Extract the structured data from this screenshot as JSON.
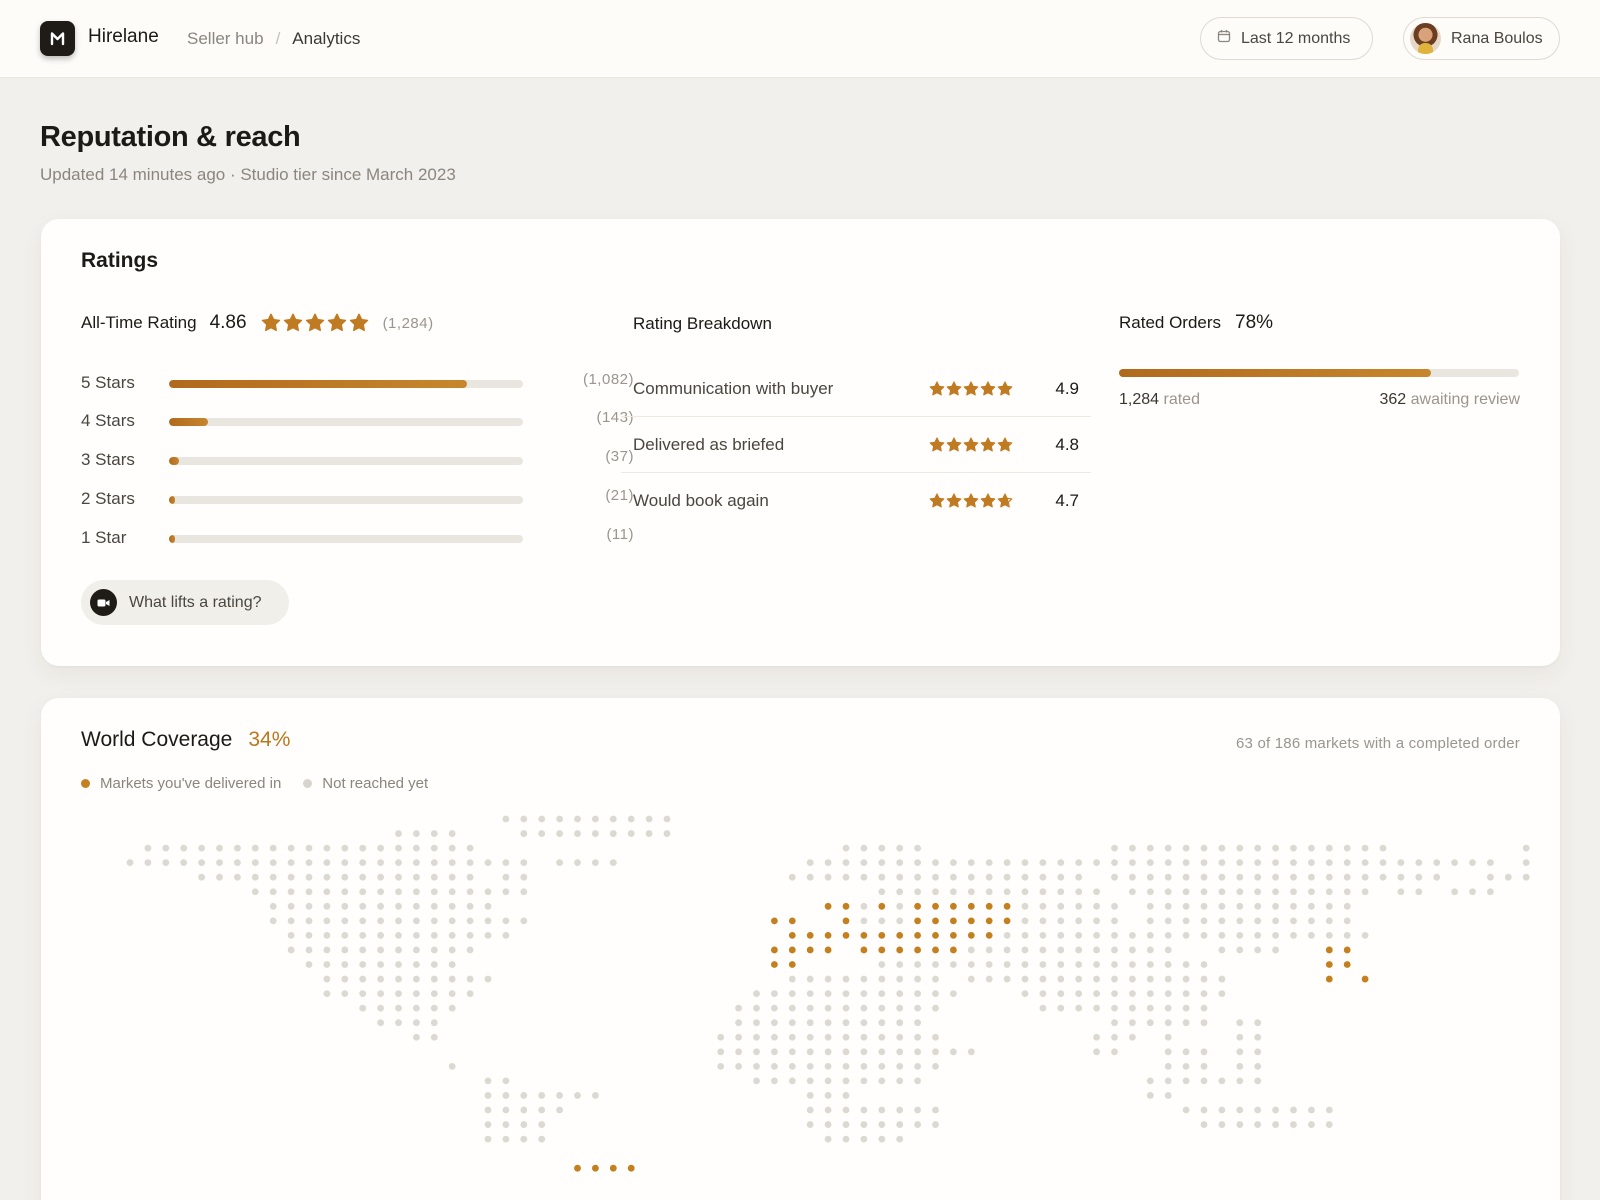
{
  "header": {
    "brand": "Hirelane",
    "breadcrumb": [
      "Seller hub",
      "Analytics"
    ],
    "date_range": "Last 12 months",
    "user_name": "Rana Boulos"
  },
  "page": {
    "title": "Reputation & reach",
    "subtitle": "Updated 14 minutes ago · Studio tier since March 2023"
  },
  "ratings": {
    "title": "Ratings",
    "all_time_label": "All-Time Rating",
    "all_time_score": "4.86",
    "all_time_stars": 4.86,
    "all_time_count": "(1,284)",
    "distribution": [
      {
        "label": "5 Stars",
        "count": "(1,082)",
        "fraction": 0.843
      },
      {
        "label": "4 Stars",
        "count": "(143)",
        "fraction": 0.111
      },
      {
        "label": "3 Stars",
        "count": "(37)",
        "fraction": 0.029
      },
      {
        "label": "2 Stars",
        "count": "(21)",
        "fraction": 0.016
      },
      {
        "label": "1 Star",
        "count": "(11)",
        "fraction": 0.009
      }
    ],
    "help_label": "What lifts a rating?",
    "breakdown_title": "Rating Breakdown",
    "breakdown": [
      {
        "label": "Communication with buyer",
        "value": "4.9",
        "stars": 4.9
      },
      {
        "label": "Delivered as briefed",
        "value": "4.8",
        "stars": 4.8
      },
      {
        "label": "Would book again",
        "value": "4.7",
        "stars": 4.7
      }
    ],
    "rated_orders_label": "Rated Orders",
    "rated_orders_pct": "78%",
    "rated_orders_fraction": 0.78,
    "rated_count": "1,284",
    "rated_suffix": "rated",
    "awaiting_count": "362",
    "awaiting_suffix": "awaiting review"
  },
  "coverage": {
    "title": "World Coverage",
    "pct": "34%",
    "note": "63 of 186 markets with a completed order",
    "legend_delivered": "Markets you've delivered in",
    "legend_not_reached": "Not reached yet"
  },
  "colors": {
    "accent": "#b8781f",
    "star": "#c07a22",
    "track": "#e9e6df",
    "dot_grey": "#dcd9d2",
    "dot_gold": "#c4801f",
    "background": "#f2f0ec",
    "card": "#fffefc"
  },
  "icons": {
    "logo": "hirelane-logo-icon",
    "date": "calendar-icon",
    "help": "video-camera-icon",
    "stars": "star-icon"
  }
}
